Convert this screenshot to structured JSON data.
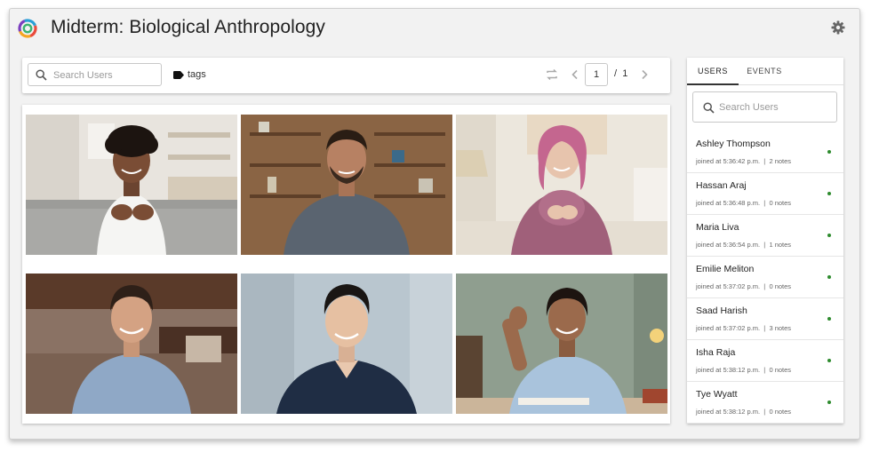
{
  "app": {
    "title": "Midterm: Biological Anthropology"
  },
  "toolbar": {
    "search_placeholder": "Search Users",
    "tags_label": "tags",
    "current_page": "1",
    "page_separator": "/",
    "total_pages": "1"
  },
  "participants": [
    {
      "name": "Ashley Thompson"
    },
    {
      "name": "Hassan Araj"
    },
    {
      "name": "Maria Liva"
    },
    {
      "name": "Emilie Meliton"
    },
    {
      "name": "Saad Harish"
    },
    {
      "name": "Isha Raja"
    }
  ],
  "sidebar": {
    "tabs": [
      {
        "label": "USERS"
      },
      {
        "label": "EVENTS"
      }
    ],
    "search_placeholder": "Search Users",
    "users": [
      {
        "name": "Ashley Thompson",
        "joined": "joined at 5:36:42 p.m.",
        "notes": "2 notes"
      },
      {
        "name": "Hassan Araj",
        "joined": "joined at 5:36:48 p.m.",
        "notes": "0 notes"
      },
      {
        "name": "Maria Liva",
        "joined": "joined at 5:36:54 p.m.",
        "notes": "1 notes"
      },
      {
        "name": "Emilie Meliton",
        "joined": "joined at 5:37:02 p.m.",
        "notes": "0 notes"
      },
      {
        "name": "Saad Harish",
        "joined": "joined at 5:37:02 p.m.",
        "notes": "3 notes"
      },
      {
        "name": "Isha Raja",
        "joined": "joined at 5:38:12 p.m.",
        "notes": "0 notes"
      },
      {
        "name": "Tye Wyatt",
        "joined": "joined at 5:38:12 p.m.",
        "notes": "0 notes"
      }
    ]
  },
  "icons": {
    "logo": "app-logo",
    "settings": "gear-icon",
    "search": "search-icon",
    "tag": "tag-icon",
    "refresh": "refresh-icon",
    "prev": "chevron-left-icon",
    "next": "chevron-right-icon"
  },
  "colors": {
    "online": "#2e8b2e",
    "background": "#f2f2f2"
  }
}
